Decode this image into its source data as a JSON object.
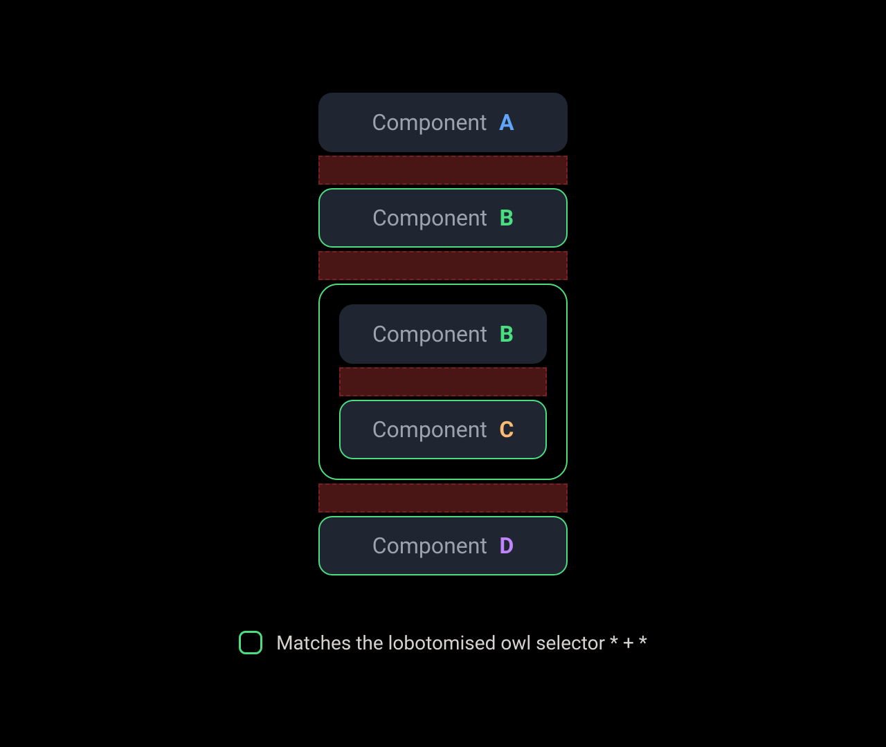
{
  "components": {
    "prefix": "Component",
    "a": "A",
    "b": "B",
    "c": "C",
    "d": "D"
  },
  "legend": {
    "text": "Matches the lobotomised owl selector * + *"
  },
  "colors": {
    "matched_border": "#4ade80",
    "component_bg": "#1f2631",
    "gap_bg": "#4a1515",
    "gap_border": "#7a2020",
    "letter_a": "#60a5fa",
    "letter_b": "#4ade80",
    "letter_c": "#fdba74",
    "letter_d": "#c084fc"
  }
}
